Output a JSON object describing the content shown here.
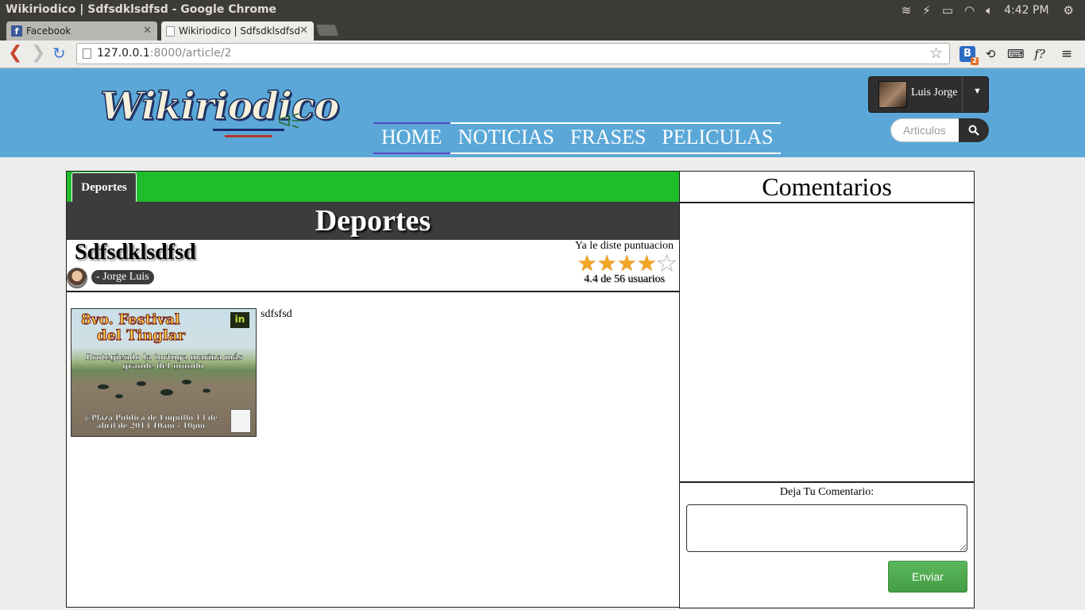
{
  "window": {
    "title": "Wikiriodico | Sdfsdklsdfsd - Google Chrome",
    "clock": "4:42 PM"
  },
  "tabs": [
    {
      "label": "Facebook",
      "favicon": "facebook-icon",
      "active": false
    },
    {
      "label": "Wikiriodico | Sdfsdklsdfsd",
      "favicon": "page-icon",
      "active": true
    }
  ],
  "toolbar": {
    "url_host": "127.0.0.1",
    "url_rest": ":8000/article/2",
    "ext_badge": "2",
    "ext_b_letter": "B",
    "ext_f_label": "f?"
  },
  "site": {
    "logo_text": "Wikiriodico",
    "nav": [
      "HOME",
      "NOTICIAS",
      "FRASES",
      "PELICULAS"
    ],
    "active_nav": "HOME",
    "user_name": "Luis Jorge",
    "search_placeholder": "Articulos"
  },
  "article": {
    "category_tab": "Deportes",
    "category_banner": "Deportes",
    "title": "Sdfsdklsdfsd",
    "author": "- Jorge Luis",
    "rating_note": "Ya le diste puntuacion",
    "rating": 4.4,
    "rating_max": 5,
    "rating_summary": "4.4 de 56 usuarios",
    "body": "sdfsfsd",
    "poster": {
      "line1": "8vo. Festival",
      "line2": "del Tinglar",
      "line3": "Protegiendo la tortuga marina más grande del mundo.",
      "line4": "@Plaza Pública de Luquillo 13 de abril de 2013 10am - 10pm",
      "logo": "in"
    }
  },
  "comments": {
    "title": "Comentarios",
    "form_label": "Deja Tu Comentario:",
    "textarea_value": "",
    "submit_label": "Enviar"
  },
  "colors": {
    "header_bg": "#5ba8d8",
    "category_green": "#1fbd2b",
    "banner_dark": "#3c3c3c",
    "submit_green": "#5cb85c",
    "star": "#f2a424"
  }
}
